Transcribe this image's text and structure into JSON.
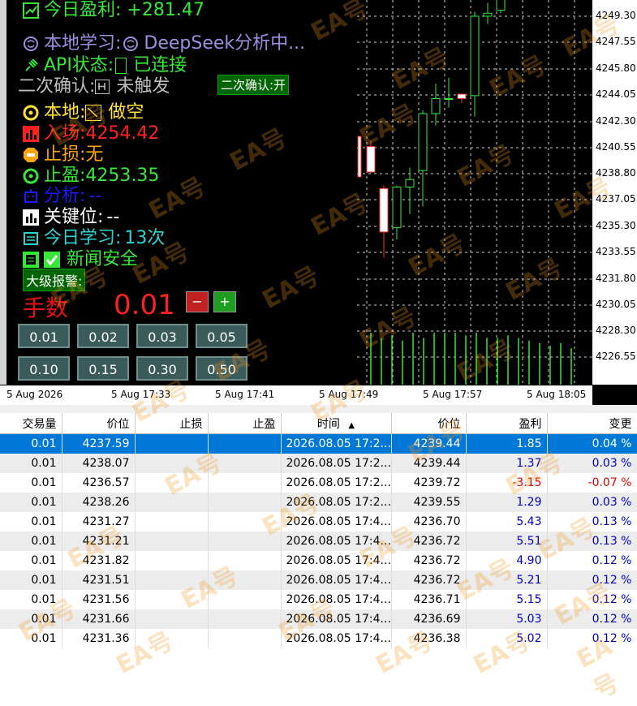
{
  "panel": {
    "profit_label": "今日盈利: +281.47",
    "learn_label": "本地学习: ",
    "learn_value": "DeepSeek分析中...",
    "api_label": "API状态: ",
    "api_value": "已连接",
    "confirm_label": "二次确认: ",
    "confirm_value": "未触发",
    "confirm_button": "二次确认:开",
    "local_label": "本地:",
    "local_value": "做空",
    "entry_label": "入场:",
    "entry_value": "4254.42",
    "sl_label": "止损:",
    "sl_value": "无",
    "tp_label": "止盈:",
    "tp_value": "4253.35",
    "analysis_label": "分析:",
    "analysis_value": "--",
    "key_label": "关键位:",
    "key_value": "--",
    "learn_today_label": "今日学习:",
    "learn_today_value": "13次",
    "news_label": "新闻安全",
    "alarm_button": "大级报警:",
    "lots_label": "手数",
    "lots_value": "0.01",
    "minus": "−",
    "plus": "+",
    "lot_options": [
      "0.01",
      "0.02",
      "0.03",
      "0.05",
      "0.10",
      "0.15",
      "0.30",
      "0.50"
    ]
  },
  "colors": {
    "profit": "#38e838",
    "learn": "#9a8fe0",
    "api": "#38e838",
    "confirm": "#bdbdbd",
    "local": "#ffe135",
    "entry": "#ff2020",
    "sl": "#ffa500",
    "tp": "#38e838",
    "analysis": "#1a1aff",
    "key": "#ffffff",
    "learn_today": "#2dd4d4",
    "news": "#38e838",
    "lots_label": "#e81010",
    "lots_value": "#ff2020"
  },
  "price_ticks": [
    "4249.30",
    "4247.55",
    "4245.80",
    "4244.05",
    "4242.30",
    "4240.55",
    "4238.80",
    "4237.05",
    "4235.30",
    "4233.55",
    "4231.80",
    "4230.05",
    "4228.30",
    "4226.55"
  ],
  "time_ticks": [
    "5 Aug 2026",
    "5 Aug 17:33",
    "5 Aug 17:41",
    "5 Aug 17:49",
    "5 Aug 17:57",
    "5 Aug 18:05"
  ],
  "candles": [
    {
      "o": 4240.6,
      "c": 4238.9,
      "h": 4241.0,
      "l": 4238.8
    },
    {
      "o": 4237.8,
      "c": 4234.9,
      "h": 4238.0,
      "l": 4233.2
    },
    {
      "o": 4235.2,
      "c": 4237.9,
      "h": 4238.0,
      "l": 4234.4
    },
    {
      "o": 4237.9,
      "c": 4238.4,
      "h": 4239.2,
      "l": 4236.1
    },
    {
      "o": 4239.0,
      "c": 4242.8,
      "h": 4243.0,
      "l": 4236.6
    },
    {
      "o": 4242.8,
      "c": 4243.8,
      "h": 4244.8,
      "l": 4242.0
    },
    {
      "o": 4243.8,
      "c": 4243.8,
      "h": 4245.2,
      "l": 4243.2
    },
    {
      "o": 4244.1,
      "c": 4243.8,
      "h": 4244.1,
      "l": 4243.5
    },
    {
      "o": 4244.0,
      "c": 4249.3,
      "h": 4249.6,
      "l": 4242.6
    },
    {
      "o": 4249.3,
      "c": 4249.5,
      "h": 4250.2,
      "l": 4248.8
    },
    {
      "o": 4249.7,
      "c": 4250.6,
      "h": 4250.9,
      "l": 4249.5
    }
  ],
  "volumes": [
    1,
    0.9,
    0.95,
    0.85,
    1,
    0.9,
    1,
    1,
    1,
    0.95,
    1,
    0.9,
    0.9,
    0.95,
    0.9,
    0.85,
    0.8,
    0.75,
    0.8,
    0.7
  ],
  "table": {
    "headers": [
      "交易量",
      "价位",
      "止损",
      "止盈",
      "时间",
      "价位",
      "盈利",
      "变更"
    ],
    "sort_arrow": "▲",
    "rows": [
      [
        "0.01",
        "4237.59",
        "",
        "",
        "2026.08.05 17:2...",
        "4239.44",
        "1.85",
        "0.04 %"
      ],
      [
        "0.01",
        "4238.07",
        "",
        "",
        "2026.08.05 17:2...",
        "4239.44",
        "1.37",
        "0.03 %"
      ],
      [
        "0.01",
        "4236.57",
        "",
        "",
        "2026.08.05 17:2...",
        "4239.72",
        "-3.15",
        "-0.07 %"
      ],
      [
        "0.01",
        "4238.26",
        "",
        "",
        "2026.08.05 17:2...",
        "4239.55",
        "1.29",
        "0.03 %"
      ],
      [
        "0.01",
        "4231.27",
        "",
        "",
        "2026.08.05 17:4...",
        "4236.70",
        "5.43",
        "0.13 %"
      ],
      [
        "0.01",
        "4231.21",
        "",
        "",
        "2026.08.05 17:4...",
        "4236.72",
        "5.51",
        "0.13 %"
      ],
      [
        "0.01",
        "4231.82",
        "",
        "",
        "2026.08.05 17:4...",
        "4236.72",
        "4.90",
        "0.12 %"
      ],
      [
        "0.01",
        "4231.51",
        "",
        "",
        "2026.08.05 17:4...",
        "4236.72",
        "5.21",
        "0.12 %"
      ],
      [
        "0.01",
        "4231.56",
        "",
        "",
        "2026.08.05 17:4...",
        "4236.71",
        "5.15",
        "0.12 %"
      ],
      [
        "0.01",
        "4231.66",
        "",
        "",
        "2026.08.05 17:4...",
        "4236.69",
        "5.03",
        "0.12 %"
      ],
      [
        "0.01",
        "4231.36",
        "",
        "",
        "2026.08.05 17:4...",
        "4236.38",
        "5.02",
        "0.12 %"
      ]
    ]
  },
  "watermark": "EA号"
}
